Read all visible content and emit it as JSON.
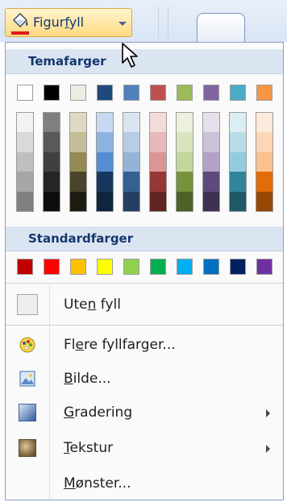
{
  "ribbon": {
    "button_prefix": "Figur",
    "button_underline": "f",
    "button_suffix": "yll"
  },
  "colors": {
    "menu_border": "#8aa0c2",
    "section_bg": "#dbe5f2",
    "section_text": "#15376d"
  },
  "theme_section": {
    "title": "Temafarger"
  },
  "theme_colors": [
    "#ffffff",
    "#000000",
    "#eeece1",
    "#1f497d",
    "#4f81bd",
    "#c0504d",
    "#9bbb59",
    "#8064a2",
    "#4bacc6",
    "#f79646"
  ],
  "theme_tints": [
    [
      "#f2f2f2",
      "#d9d9d9",
      "#bfbfbf",
      "#a6a6a6",
      "#808080"
    ],
    [
      "#7f7f7f",
      "#595959",
      "#404040",
      "#262626",
      "#0d0d0d"
    ],
    [
      "#ddd9c3",
      "#c4bd97",
      "#948a54",
      "#4a452a",
      "#1e1c11"
    ],
    [
      "#c6d9f1",
      "#8db3e2",
      "#548dd4",
      "#17375e",
      "#0f243e"
    ],
    [
      "#dbe5f1",
      "#b8cce4",
      "#95b3d7",
      "#366092",
      "#244061"
    ],
    [
      "#f2dcdb",
      "#e6b9b8",
      "#d99694",
      "#953734",
      "#632423"
    ],
    [
      "#ebf1dd",
      "#d7e4bd",
      "#c3d69b",
      "#76923c",
      "#4f6128"
    ],
    [
      "#e5e0ec",
      "#ccc1da",
      "#b2a2c7",
      "#5f497a",
      "#3f3151"
    ],
    [
      "#dbeef3",
      "#b7dde8",
      "#93cddd",
      "#31859b",
      "#205867"
    ],
    [
      "#fdeada",
      "#fbd5b5",
      "#fac08f",
      "#e36c09",
      "#974806"
    ]
  ],
  "standard_section": {
    "title": "Standardfarger"
  },
  "standard_colors": [
    "#c00000",
    "#ff0000",
    "#ffc000",
    "#ffff00",
    "#92d050",
    "#00b050",
    "#00b0f0",
    "#0070c0",
    "#002060",
    "#7030a0"
  ],
  "items": {
    "no_fill": {
      "before": "Ute",
      "ul": "n",
      "after": " fyll"
    },
    "more_colors": {
      "before": "Fl",
      "ul": "e",
      "after": "re fyllfarger..."
    },
    "picture": {
      "before": "",
      "ul": "B",
      "after": "ilde..."
    },
    "gradient": {
      "before": "",
      "ul": "G",
      "after": "radering"
    },
    "texture": {
      "before": "",
      "ul": "T",
      "after": "ekstur"
    },
    "pattern": {
      "before": "",
      "ul": "M",
      "after": "ønster..."
    }
  }
}
